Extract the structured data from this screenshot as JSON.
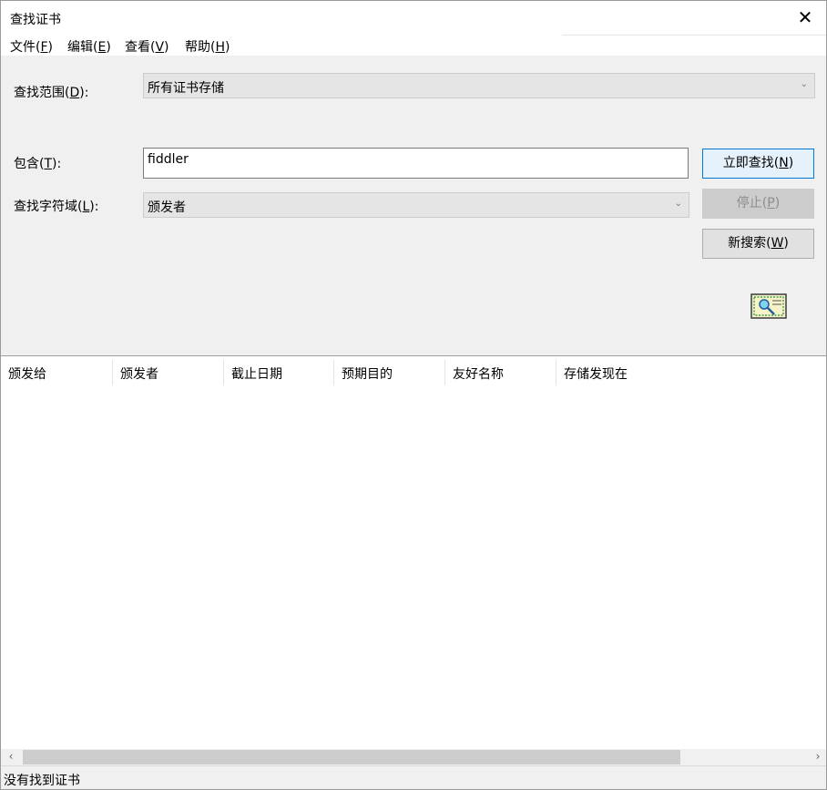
{
  "window": {
    "title": "查找证书",
    "close_glyph": "✕"
  },
  "menu": [
    {
      "label": "文件(",
      "acc": "F",
      "tail": ")"
    },
    {
      "label": "编辑(",
      "acc": "E",
      "tail": ")"
    },
    {
      "label": "查看(",
      "acc": "V",
      "tail": ")"
    },
    {
      "label": "帮助(",
      "acc": "H",
      "tail": ")"
    }
  ],
  "search": {
    "scope_label_pre": "查找范围(",
    "scope_label_acc": "D",
    "scope_label_post": "):",
    "scope_value": "所有证书存储",
    "contains_label_pre": "包含(",
    "contains_label_acc": "T",
    "contains_label_post": "):",
    "contains_value": "fiddler",
    "field_label_pre": "查找字符域(",
    "field_label_acc": "L",
    "field_label_post": "):",
    "field_value": "颁发者",
    "chevron": "⌄"
  },
  "buttons": {
    "find_now_pre": "立即查找(",
    "find_now_acc": "N",
    "find_now_post": ")",
    "stop_pre": "停止(",
    "stop_acc": "P",
    "stop_post": ")",
    "new_search_pre": "新搜索(",
    "new_search_acc": "W",
    "new_search_post": ")"
  },
  "columns": [
    "颁发给",
    "颁发者",
    "截止日期",
    "预期目的",
    "友好名称",
    "存储发现在"
  ],
  "scrollbar": {
    "left_arrow": "‹",
    "right_arrow": "›"
  },
  "status": {
    "text": "没有找到证书"
  },
  "icons": {
    "search_certificate": "certificate-search-icon"
  }
}
